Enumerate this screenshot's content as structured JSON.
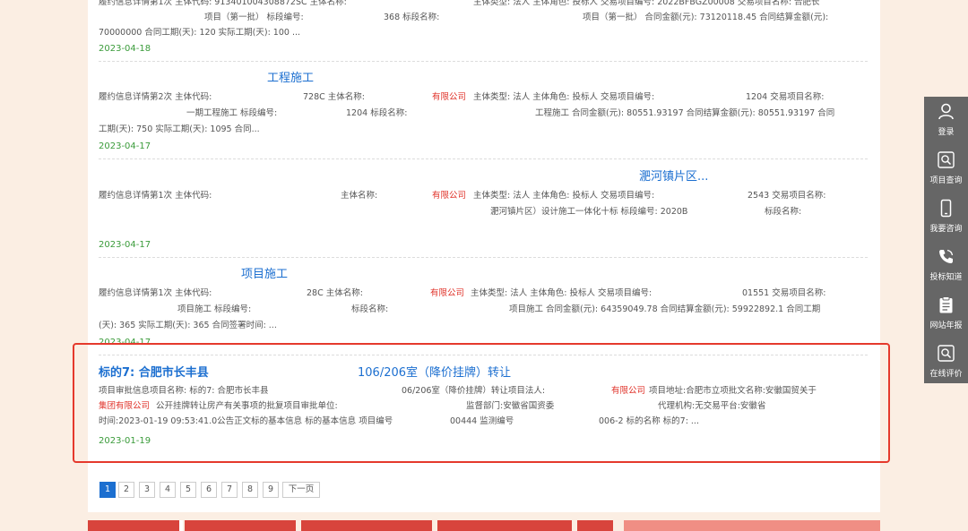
{
  "item0": {
    "line1": {
      "s1": "履约信息详情第1次 主体代码:   913401004308872SC 主体名称:",
      "s2": "主体类型: 法人 主体角色: 投标人 交易项目编号:  2022BFBGZ00008 交易项目名称:  合肥长"
    },
    "line2": {
      "s1": "项目（第一批） 标段编号:",
      "s2": "368 标段名称:",
      "s3": "项目（第一批） 合同金额(元):  73120118.45 合同结算金额(元):"
    },
    "line3": "70000000 合同工期(天):  120 实际工期(天):  100 ...",
    "date": "2023-04-18"
  },
  "item1": {
    "title": "工程施工",
    "line1": {
      "s1": "履约信息详情第2次 主体代码:",
      "s2": "728C 主体名称:",
      "s3": "有限公司",
      "s4": "主体类型:  法人  主体角色:  投标人  交易项目编号:",
      "s5": "1204 交易项目名称:"
    },
    "line2": {
      "s1": "一期工程施工 标段编号:",
      "s2": "1204 标段名称:",
      "s3": "工程施工 合同金额(元):  80551.93197 合同结算金额(元):  80551.93197 合同"
    },
    "line3": "工期(天):  750 实际工期(天):  1095 合同...",
    "date": "2023-04-17"
  },
  "item2": {
    "title": "淝河镇片区...",
    "line1": {
      "s1": "履约信息详情第1次 主体代码:",
      "s2": "主体名称:",
      "s3": "有限公司",
      "s4": "主体类型:  法人  主体角色:  投标人  交易项目编号:",
      "s5": "2543 交易项目名称:"
    },
    "line2": {
      "s1": "淝河镇片区）设计施工一体化十标 标段编号:  2020B",
      "s2": "标段名称:"
    },
    "date": "2023-04-17"
  },
  "item3": {
    "title": "项目施工",
    "line1": {
      "s1": "履约信息详情第1次 主体代码:",
      "s2": "28C 主体名称:",
      "s3": "有限公司",
      "s4": "主体类型:  法人  主体角色:  投标人  交易项目编号:",
      "s5": "01551 交易项目名称:"
    },
    "line2": {
      "s1": "项目施工 标段编号:",
      "s2": "标段名称:",
      "s3": "项目施工 合同金额(元):  64359049.78 合同结算金额(元):  59922892.1 合同工期"
    },
    "line3": "(天):  365 实际工期(天):  365 合同签署时间:  ...",
    "date": "2023-04-17"
  },
  "item4": {
    "title_a": "标的7: 合肥市长丰县",
    "title_b": "106/206室（降价挂牌）转让",
    "line1": {
      "s1": "项目审批信息项目名称:  标的7:  合肥市长丰县",
      "s2": "06/206室（降价挂牌）转让项目法人:",
      "s3": "有限公司",
      "s4": "项目地址:合肥市立项批文名称:安徽国贸关于"
    },
    "line2": {
      "s1": "集团有限公司",
      "s2": "公开挂牌转让房产有关事项的批复项目审批单位:",
      "s3": "监督部门:安徽省国资委",
      "s4": "代理机构:无交易平台:安徽省"
    },
    "line3": {
      "s1": "时间:2023-01-19 09:53:41.0公告正文标的基本信息 标的基本信息 项目编号",
      "s2": "00444 监测编号",
      "s3": "006-2 标的名称 标的7: ..."
    },
    "date": "2023-01-19"
  },
  "pager": {
    "pages": [
      "1",
      "2",
      "3",
      "4",
      "5",
      "6",
      "7",
      "8",
      "9"
    ],
    "next": "下一页"
  },
  "sidebar": {
    "login": "登录",
    "project_query": "项目查询",
    "consult": "我要咨询",
    "bidding": "投标知道",
    "annual_report": "网站年报",
    "evaluate": "在线评价"
  },
  "colors": {
    "accent": "#1c6fd0",
    "red": "#e0342b",
    "date_green": "#3a9b3a",
    "highlight": "#e5392c",
    "sidebar": "#666666"
  }
}
